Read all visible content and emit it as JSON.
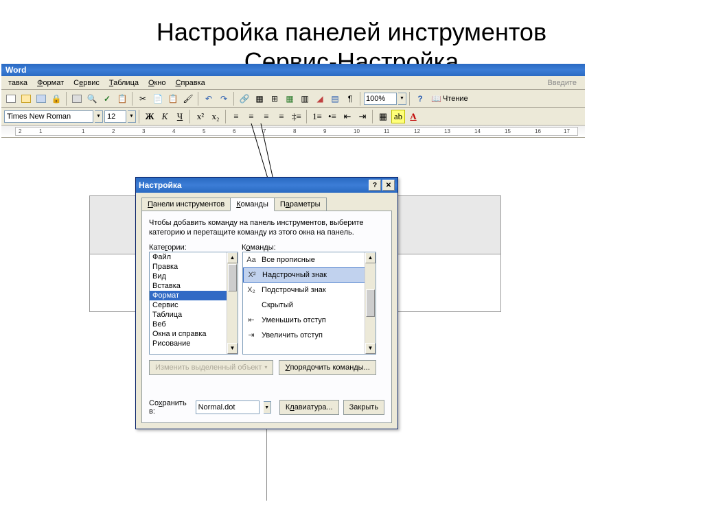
{
  "slide": {
    "title_line1": "Настройка панелей инструментов",
    "title_line2": "Сервис-Настройка"
  },
  "word": {
    "title": "Word",
    "menu": {
      "vstavka": "тавка",
      "format": "Формат",
      "service": "Сервис",
      "table": "Таблица",
      "window": "Окно",
      "help": "Справка"
    },
    "type_help": "Введите",
    "zoom": "100%",
    "reading": "Чтение",
    "font_name": "Times New Roman",
    "font_size": "12"
  },
  "dialog": {
    "title": "Настройка",
    "tabs": {
      "toolbars": "Панели инструментов",
      "commands": "Команды",
      "options": "Параметры"
    },
    "hint1": "Чтобы добавить команду на панель инструментов, выберите",
    "hint2": "категорию и перетащите команду из этого окна на панель.",
    "cat_label": "Категории:",
    "cmd_label": "Команды:",
    "categories": [
      "Файл",
      "Правка",
      "Вид",
      "Вставка",
      "Формат",
      "Сервис",
      "Таблица",
      "Веб",
      "Окна и справка",
      "Рисование"
    ],
    "selected_category_index": 4,
    "commands": [
      {
        "icon": "Аа",
        "label": "Все прописные"
      },
      {
        "icon": "X²",
        "label": "Надстрочный знак"
      },
      {
        "icon": "X₂",
        "label": "Подстрочный знак"
      },
      {
        "icon": "",
        "label": "Скрытый"
      },
      {
        "icon": "⇤",
        "label": "Уменьшить отступ"
      },
      {
        "icon": "⇥",
        "label": "Увеличить отступ"
      }
    ],
    "selected_command_index": 1,
    "modify_btn": "Изменить выделенный объект",
    "arrange_btn": "Упорядочить команды...",
    "save_in_label": "Сохранить в:",
    "save_in_value": "Normal.dot",
    "keyboard_btn": "Клавиатура...",
    "close_btn": "Закрыть"
  }
}
